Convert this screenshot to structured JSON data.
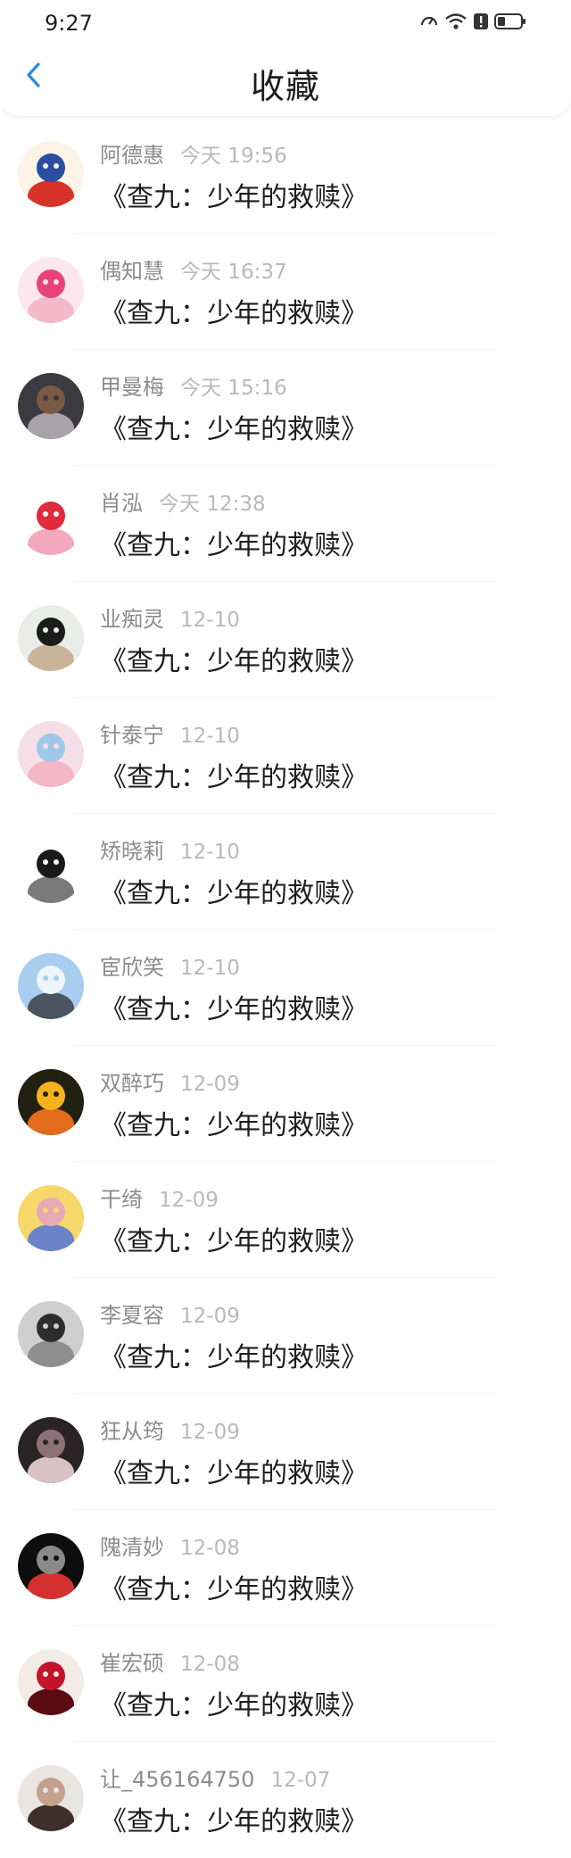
{
  "status_bar": {
    "time": "9:27"
  },
  "header": {
    "title": "收藏"
  },
  "favorites": [
    {
      "name": "阿德惠",
      "time": "今天 19:56",
      "title": "《查九：少年的救赎》",
      "avatar_icon": "cartoon-character-avatar",
      "avatar_colors": [
        "#fdf3e6",
        "#2a4fa0",
        "#d8332b"
      ]
    },
    {
      "name": "偶知慧",
      "time": "今天 16:37",
      "title": "《查九：少年的救赎》",
      "avatar_icon": "cartoon-girl-avatar",
      "avatar_colors": [
        "#fde7ef",
        "#e8427a",
        "#f4b9cb"
      ]
    },
    {
      "name": "甲曼梅",
      "time": "今天 15:16",
      "title": "《查九：少年的救赎》",
      "avatar_icon": "photo-avatar",
      "avatar_colors": [
        "#3b3a40",
        "#7a5a45",
        "#a7a3a8"
      ]
    },
    {
      "name": "肖泓",
      "time": "今天 12:38",
      "title": "《查九：少年的救赎》",
      "avatar_icon": "cartoon-doll-avatar",
      "avatar_colors": [
        "#ffffff",
        "#e02b3c",
        "#f3a8c0"
      ]
    },
    {
      "name": "业痴灵",
      "time": "12-10",
      "title": "《查九：少年的救赎》",
      "avatar_icon": "photo-avatar",
      "avatar_colors": [
        "#e9ece8",
        "#1b1b1b",
        "#c9b49a"
      ]
    },
    {
      "name": "针泰宁",
      "time": "12-10",
      "title": "《查九：少年的救赎》",
      "avatar_icon": "anime-girl-avatar",
      "avatar_colors": [
        "#f5dfe7",
        "#9fc7e8",
        "#f2b6c4"
      ]
    },
    {
      "name": "矫晓莉",
      "time": "12-10",
      "title": "《查九：少年的救赎》",
      "avatar_icon": "ink-drawing-avatar",
      "avatar_colors": [
        "#ffffff",
        "#1a1a1a",
        "#7a7a7a"
      ]
    },
    {
      "name": "宦欣笑",
      "time": "12-10",
      "title": "《查九：少年的救赎》",
      "avatar_icon": "snow-tree-avatar",
      "avatar_colors": [
        "#a8cdef",
        "#eef5fb",
        "#4a5560"
      ]
    },
    {
      "name": "双醉巧",
      "time": "12-09",
      "title": "《查九：少年的救赎》",
      "avatar_icon": "yellow-rose-avatar",
      "avatar_colors": [
        "#222010",
        "#f5b21f",
        "#e46b1c"
      ]
    },
    {
      "name": "干绮",
      "time": "12-09",
      "title": "《查九：少年的救赎》",
      "avatar_icon": "anime-avatar",
      "avatar_colors": [
        "#f6d86a",
        "#e8a8b8",
        "#6a83c9"
      ]
    },
    {
      "name": "李夏容",
      "time": "12-09",
      "title": "《查九：少年的救赎》",
      "avatar_icon": "photo-avatar",
      "avatar_colors": [
        "#cfcfcf",
        "#2d2d2d",
        "#8e8e8e"
      ]
    },
    {
      "name": "狂从筠",
      "time": "12-09",
      "title": "《查九：少年的救赎》",
      "avatar_icon": "portrait-avatar",
      "avatar_colors": [
        "#2a2326",
        "#8c7278",
        "#d8c2c3"
      ]
    },
    {
      "name": "隗清妙",
      "time": "12-08",
      "title": "《查九：少年的救赎》",
      "avatar_icon": "warrior-avatar",
      "avatar_colors": [
        "#0e0e0e",
        "#8a8a8a",
        "#d43030"
      ]
    },
    {
      "name": "崔宏硕",
      "time": "12-08",
      "title": "《查九：少年的救赎》",
      "avatar_icon": "heart-tree-avatar",
      "avatar_colors": [
        "#f3ece6",
        "#c2142a",
        "#5b0c12"
      ]
    },
    {
      "name": "让_456164750",
      "time": "12-07",
      "title": "《查九：少年的救赎》",
      "avatar_icon": "photo-avatar",
      "avatar_colors": [
        "#e9e6e2",
        "#c3a18c",
        "#3d2e2a"
      ]
    }
  ]
}
